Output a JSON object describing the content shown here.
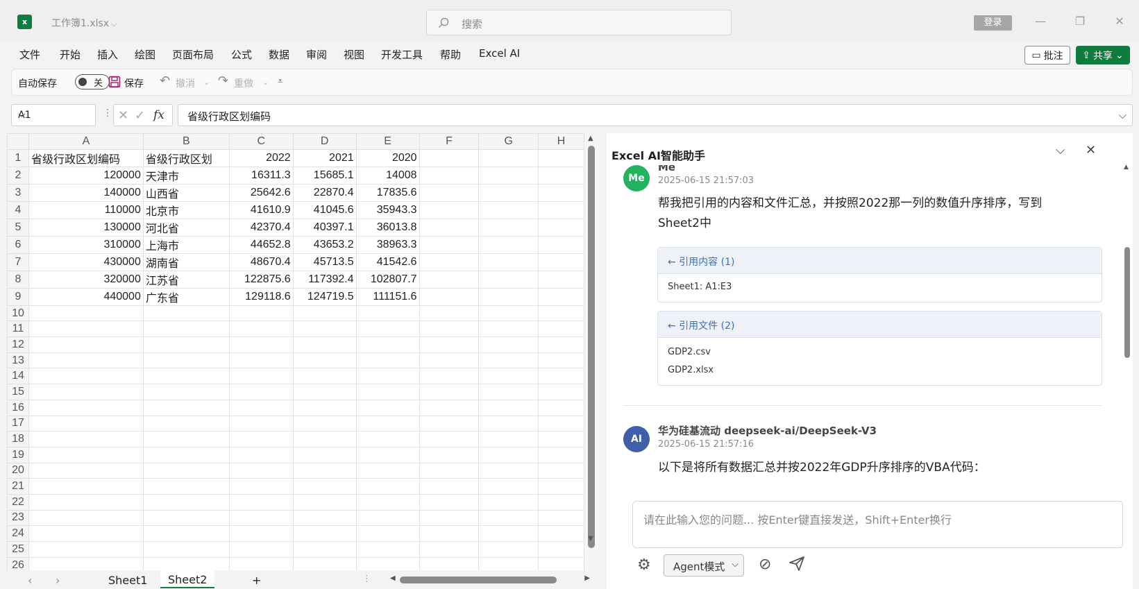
{
  "app": {
    "file_name": "工作簿1.xlsx",
    "logo_letter": "x",
    "search_placeholder": "搜索",
    "login": "登录"
  },
  "menu": [
    "文件",
    "开始",
    "插入",
    "绘图",
    "页面布局",
    "公式",
    "数据",
    "审阅",
    "视图",
    "开发工具",
    "帮助",
    "Excel AI"
  ],
  "menu_right": {
    "comment": "批注",
    "share": "共享"
  },
  "qat": {
    "autosave": "自动保存",
    "toggle_state": "关",
    "save": "保存",
    "undo": "撤消",
    "redo": "重做"
  },
  "formula_bar": {
    "name_box": "A1",
    "fx": "fx",
    "content": "省级行政区划编码"
  },
  "grid": {
    "columns": [
      "A",
      "B",
      "C",
      "D",
      "E",
      "F",
      "G",
      "H"
    ],
    "rows": [
      [
        "省级行政区划编码",
        "省级行政区划",
        "2022",
        "2021",
        "2020"
      ],
      [
        "120000",
        "天津市",
        "16311.3",
        "15685.1",
        "14008"
      ],
      [
        "140000",
        "山西省",
        "25642.6",
        "22870.4",
        "17835.6"
      ],
      [
        "110000",
        "北京市",
        "41610.9",
        "41045.6",
        "35943.3"
      ],
      [
        "130000",
        "河北省",
        "42370.4",
        "40397.1",
        "36013.8"
      ],
      [
        "310000",
        "上海市",
        "44652.8",
        "43653.2",
        "38963.3"
      ],
      [
        "430000",
        "湖南省",
        "48670.4",
        "45713.5",
        "41542.6"
      ],
      [
        "320000",
        "江苏省",
        "122875.6",
        "117392.4",
        "102807.7"
      ],
      [
        "440000",
        "广东省",
        "129118.6",
        "124719.5",
        "111151.6"
      ]
    ],
    "row_count": 27
  },
  "sheets": {
    "tabs": [
      "Sheet1",
      "Sheet2"
    ],
    "active": "Sheet2",
    "add": "+"
  },
  "panel": {
    "title": "Excel AI智能助手",
    "messages": {
      "user": {
        "avatar": "Me",
        "name": "Me",
        "time": "2025-06-15 21:57:03",
        "line1": "帮我把引用的内容和文件汇总，并按照2022那一列的数值升序排序，写到",
        "line2": "Sheet2中",
        "ref_content_title": "← 引用内容 (1)",
        "ref_content_items": [
          "Sheet1: A1:E3"
        ],
        "ref_file_title": "← 引用文件 (2)",
        "ref_file_items": [
          "GDP2.csv",
          "GDP2.xlsx"
        ]
      },
      "ai": {
        "avatar": "AI",
        "name": "华为硅基流动 deepseek-ai/DeepSeek-V3",
        "time": "2025-06-15 21:57:16",
        "text": "以下是将所有数据汇总并按2022年GDP升序排序的VBA代码："
      }
    },
    "input_placeholder": "请在此输入您的问题... 按Enter键直接发送，Shift+Enter换行",
    "mode": "Agent模式"
  },
  "colors": {
    "excel_green": "#107c41",
    "user_avatar": "#22b35e",
    "ai_avatar": "#3f5fa8",
    "ref_link": "#3b6fb6"
  }
}
